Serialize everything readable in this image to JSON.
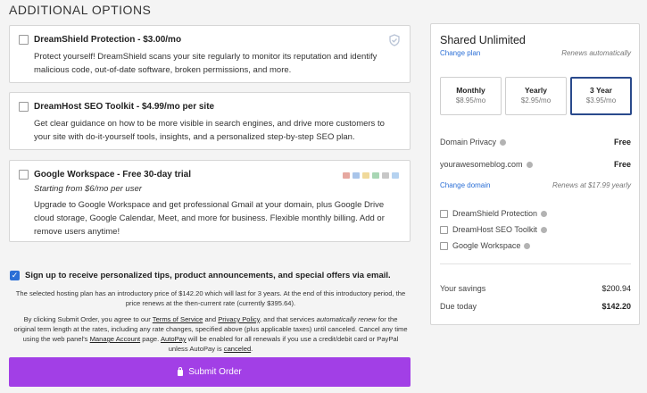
{
  "heading": "ADDITIONAL OPTIONS",
  "options": [
    {
      "title": "DreamShield Protection - $3.00/mo",
      "description": "Protect yourself! DreamShield scans your site regularly to monitor its reputation and identify malicious code, out-of-date software, broken permissions, and more.",
      "icon": "shield-icon"
    },
    {
      "title": "DreamHost SEO Toolkit - $4.99/mo per site",
      "description": "Get clear guidance on how to be more visible in search engines, and drive more customers to your site with do-it-yourself tools, insights, and a personalized step-by-step SEO plan."
    },
    {
      "title": "Google Workspace - Free 30-day trial",
      "subtitle": "Starting from $6/mo per user",
      "description": "Upgrade to Google Workspace and get professional Gmail at your domain, plus Google Drive cloud storage, Google Calendar, Meet, and more for business. Flexible monthly billing. Add or remove users anytime!",
      "icon": "google-apps-icons"
    }
  ],
  "opt_in": {
    "label": "Sign up to receive personalized tips, product announcements, and special offers via email.",
    "checked": true
  },
  "intro_notice": "The selected hosting plan has an introductory price of $142.20 which will last for 3 years. At the end of this introductory period, the price renews at the then-current rate (currently $395.64).",
  "terms": {
    "p1": "By clicking Submit Order, you agree to our ",
    "tos": "Terms of Service",
    "p2": " and ",
    "privacy": "Privacy Policy",
    "p3": ", and that services ",
    "auto_renew": "automatically renew",
    "p4": " for the original term length at the rates, including any rate changes, specified above (plus applicable taxes) until canceled. Cancel any time using the web panel's ",
    "manage": "Manage Account",
    "p5": " page. ",
    "autopay": "AutoPay",
    "p6": " will be enabled for all renewals if you use a credit/debit card or PayPal unless AutoPay is ",
    "canceled": "canceled",
    "p7": "."
  },
  "submit_label": "Submit Order",
  "summary": {
    "plan_name": "Shared Unlimited",
    "change_plan": "Change plan",
    "renews": "Renews automatically",
    "terms": [
      {
        "name": "Monthly",
        "price": "$8.95/mo",
        "selected": false
      },
      {
        "name": "Yearly",
        "price": "$2.95/mo",
        "selected": false
      },
      {
        "name": "3 Year",
        "price": "$3.95/mo",
        "selected": true
      }
    ],
    "domain_privacy_label": "Domain Privacy",
    "domain_privacy_value": "Free",
    "domain_name": "yourawesomeblog.com",
    "domain_value": "Free",
    "change_domain": "Change domain",
    "domain_renews": "Renews at $17.99 yearly",
    "addons": [
      "DreamShield Protection",
      "DreamHost SEO Toolkit",
      "Google Workspace"
    ],
    "savings_label": "Your savings",
    "savings_value": "$200.94",
    "due_label": "Due today",
    "due_value": "$142.20"
  },
  "colors": {
    "accent_blue": "#2b6fd6",
    "submit_purple": "#a23fe6",
    "selected_border": "#2a4a8c"
  }
}
